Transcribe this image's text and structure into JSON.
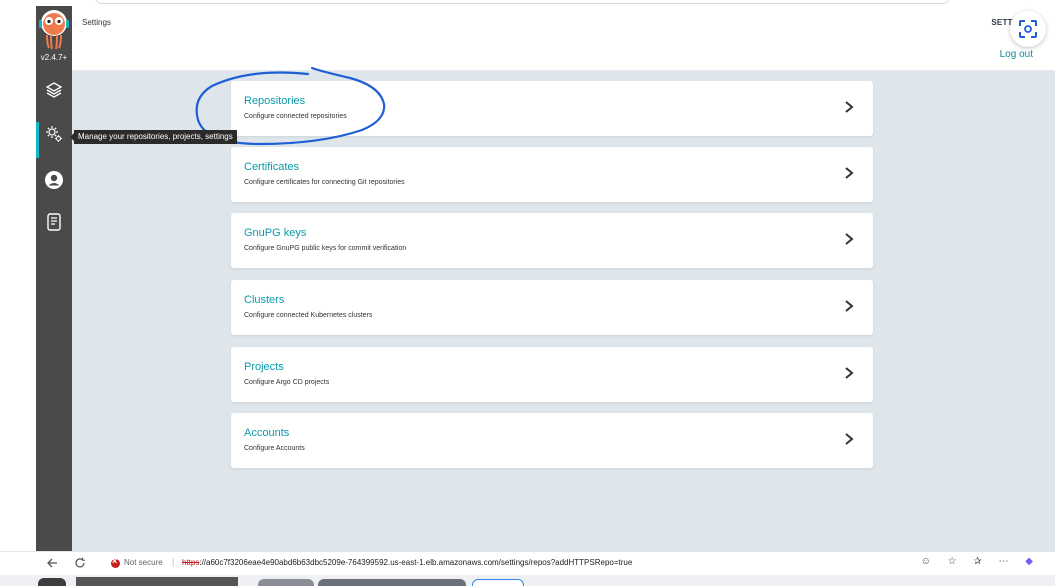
{
  "header": {
    "title": "Settings",
    "settings_label": "SETTINGS",
    "logout_label": "Log out"
  },
  "sidebar": {
    "version": "v2.4.7+",
    "tooltip": "Manage your repositories, projects, settings",
    "items": [
      {
        "icon": "layers-icon"
      },
      {
        "icon": "gear-icon"
      },
      {
        "icon": "user-icon"
      },
      {
        "icon": "docs-icon"
      }
    ]
  },
  "settings_cards": [
    {
      "title": "Repositories",
      "description": "Configure connected repositories"
    },
    {
      "title": "Certificates",
      "description": "Configure certificates for connecting Git repositories"
    },
    {
      "title": "GnuPG keys",
      "description": "Configure GnuPG public keys for commit verification"
    },
    {
      "title": "Clusters",
      "description": "Configure connected Kubernetes clusters"
    },
    {
      "title": "Projects",
      "description": "Configure Argo CD projects"
    },
    {
      "title": "Accounts",
      "description": "Configure Accounts"
    }
  ],
  "browser": {
    "security_label": "Not secure",
    "separator": "|",
    "url_scheme": "https",
    "url_rest": "://a60c7f3206eae4e90abd6b63dbc5209e-764399592.us-east-1.elb.amazonaws.com/settings/repos?addHTTPSRepo=true"
  },
  "colors": {
    "sidebar": "#4a4a4a",
    "accent": "#0b9aaa",
    "content_bg": "#dee6eb",
    "annotation": "#1f5fd6"
  }
}
